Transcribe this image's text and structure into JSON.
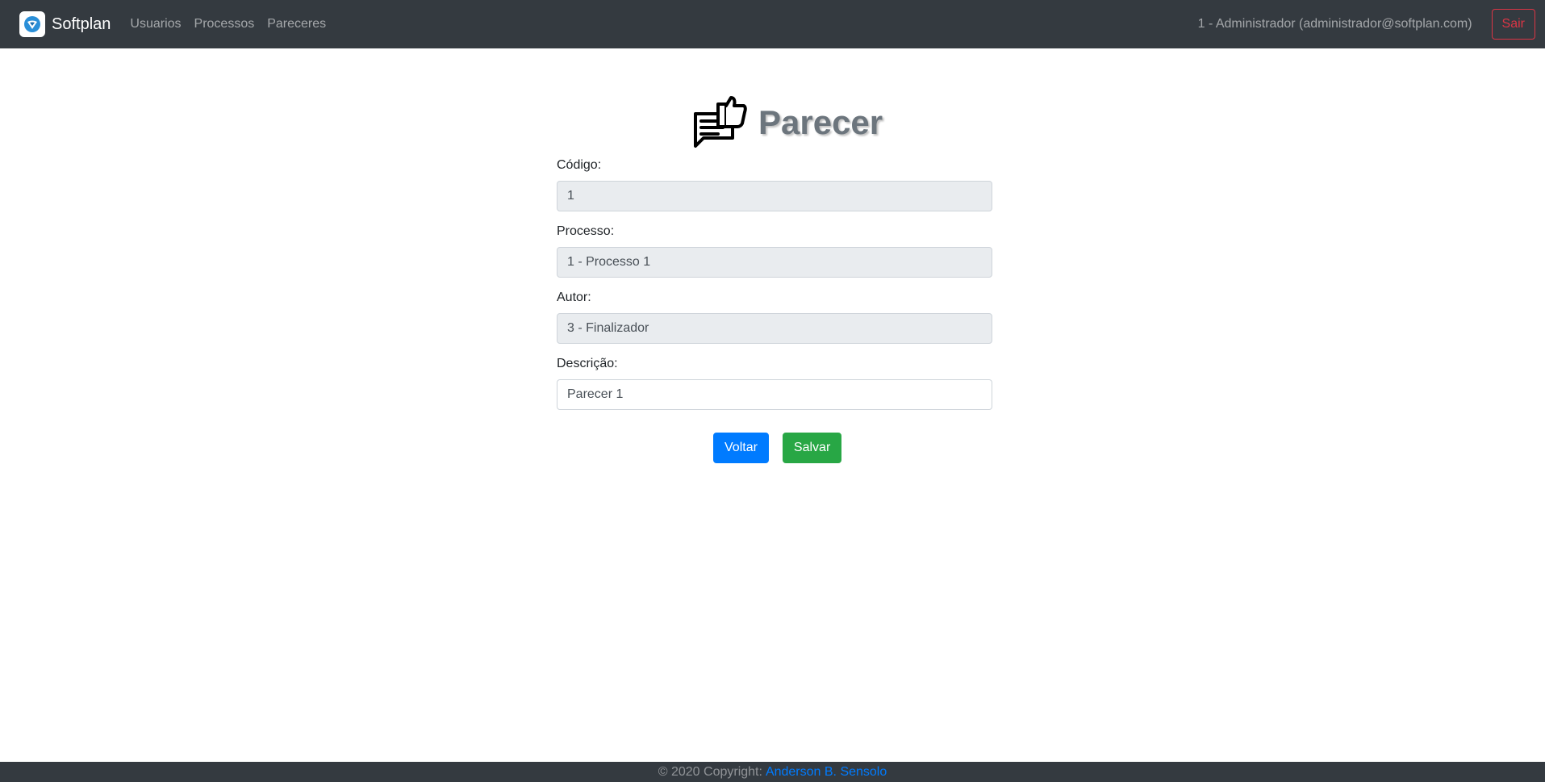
{
  "navbar": {
    "brand": "Softplan",
    "brand_icon": "softplan-logo-icon",
    "links": [
      "Usuarios",
      "Processos",
      "Pareceres"
    ],
    "user": "1 - Administrador (administrador@softplan.com)",
    "logout_label": "Sair"
  },
  "page": {
    "title": "Parecer",
    "title_icon": "thumbs-up-comment-icon"
  },
  "form": {
    "codigo": {
      "label": "Código:",
      "value": "1"
    },
    "processo": {
      "label": "Processo:",
      "value": "1 - Processo 1"
    },
    "autor": {
      "label": "Autor:",
      "value": "3 - Finalizador"
    },
    "descricao": {
      "label": "Descrição:",
      "value": "Parecer 1"
    }
  },
  "actions": {
    "back_label": "Voltar",
    "save_label": "Salvar"
  },
  "footer": {
    "text": "© 2020 Copyright:",
    "author": "Anderson B. Sensolo"
  },
  "colors": {
    "navbar": "#343a40",
    "primary": "#007bff",
    "success": "#28a745",
    "danger": "#dc3545",
    "readonly_input": "#e9ecef"
  }
}
